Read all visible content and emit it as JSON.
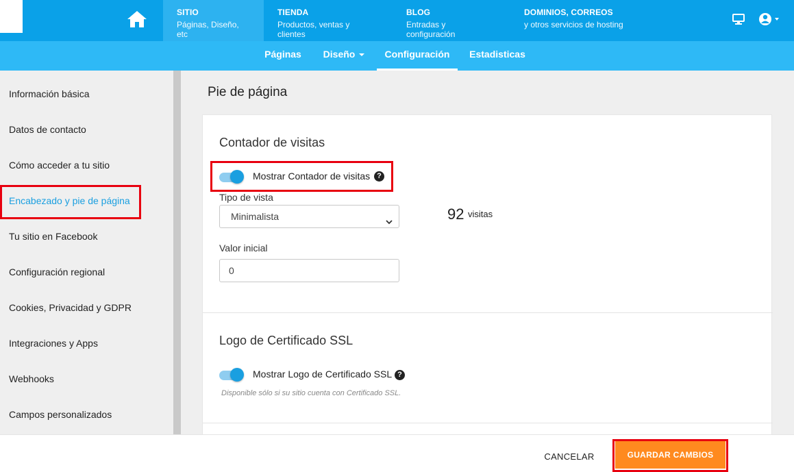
{
  "topnav": {
    "items": [
      {
        "title": "SITIO",
        "subtitle": "Páginas, Diseño, etc"
      },
      {
        "title": "TIENDA",
        "subtitle": "Productos, ventas y clientes"
      },
      {
        "title": "BLOG",
        "subtitle": "Entradas y configuración"
      },
      {
        "title": "DOMINIOS, CORREOS",
        "subtitle": "y otros servicios de hosting"
      }
    ],
    "icons": {
      "home": "home-icon",
      "preview": "monitor-icon",
      "account": "user-circle-icon"
    }
  },
  "subnav": {
    "items": [
      "Páginas",
      "Diseño",
      "Configuración",
      "Estadisticas"
    ]
  },
  "sidebar": {
    "items": [
      "Información básica",
      "Datos de contacto",
      "Cómo acceder a tu sitio",
      "Encabezado y pie de página",
      "Tu sitio en Facebook",
      "Configuración regional",
      "Cookies, Privacidad y GDPR",
      "Integraciones y Apps",
      "Webhooks",
      "Campos personalizados"
    ]
  },
  "main": {
    "title": "Pie de página",
    "counter_section": {
      "title": "Contador de visitas",
      "toggle_label": "Mostrar Contador de visitas",
      "toggle_on": true,
      "view_type_label": "Tipo de vista",
      "view_type_value": "Minimalista",
      "initial_value_label": "Valor inicial",
      "initial_value": "0",
      "preview_number": "92",
      "preview_word": "visitas"
    },
    "ssl_section": {
      "title": "Logo de Certificado SSL",
      "toggle_label": "Mostrar Logo de Certificado SSL",
      "toggle_on": true,
      "note": "Disponible sólo si su sitio cuenta con Certificado SSL."
    }
  },
  "footer": {
    "cancel_label": "CANCELAR",
    "save_label": "GUARDAR CAMBIOS"
  },
  "colors": {
    "topbar": "#0aa1e8",
    "subnav": "#2eb9f6",
    "accent": "#1a9fe0",
    "save_button": "#ff8a1f",
    "highlight": "#e8000f"
  }
}
